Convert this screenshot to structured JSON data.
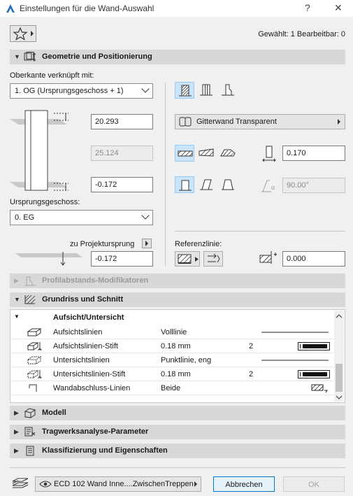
{
  "window": {
    "title": "Einstellungen für die Wand-Auswahl",
    "help_glyph": "?",
    "close_glyph": "✕"
  },
  "header": {
    "selection_info": "Gewählt: 1 Bearbeitbar: 0"
  },
  "sections": {
    "geometry": "Geometrie und Positionierung",
    "profile": "Profilabstands-Modifikatoren",
    "floorplan": "Grundriss und Schnitt",
    "model": "Modell",
    "structural": "Tragwerksanalyse-Parameter",
    "classification": "Klassifizierung und Eigenschaften"
  },
  "geometry": {
    "top_link_label": "Oberkante verknüpft mit:",
    "top_link_value": "1. OG (Ursprungsgeschoss + 1)",
    "height_top": "20.293",
    "height_total": "25.124",
    "height_bottom": "-0.172",
    "home_story_label": "Ursprungsgeschoss:",
    "home_story_value": "0. EG",
    "project_origin_label": "zu Projektursprung",
    "project_origin_value": "-0.172",
    "composite_value": "Gitterwand Transparent",
    "thickness": "0.170",
    "angle": "90.00°",
    "angle_symbol": "α",
    "reference_line_label": "Referenzlinie:",
    "reference_offset": "0.000"
  },
  "floorplan_grid": {
    "group_title": "Aufsicht/Untersicht",
    "rows": [
      {
        "name": "Aufsichtslinien",
        "value": "Volllinie",
        "extra": ""
      },
      {
        "name": "Aufsichtslinien-Stift",
        "value": "0.18 mm",
        "extra": "2"
      },
      {
        "name": "Untersichtslinien",
        "value": "Punktlinie, eng",
        "extra": ""
      },
      {
        "name": "Untersichtslinien-Stift",
        "value": "0.18 mm",
        "extra": "2"
      },
      {
        "name": "Wandabschluss-Linien",
        "value": "Beide",
        "extra": ""
      }
    ]
  },
  "footer": {
    "layer_value": "ECD 102 Wand Inne....ZwischenTreppen",
    "cancel_label": "Abbrechen",
    "ok_label": "OK"
  }
}
